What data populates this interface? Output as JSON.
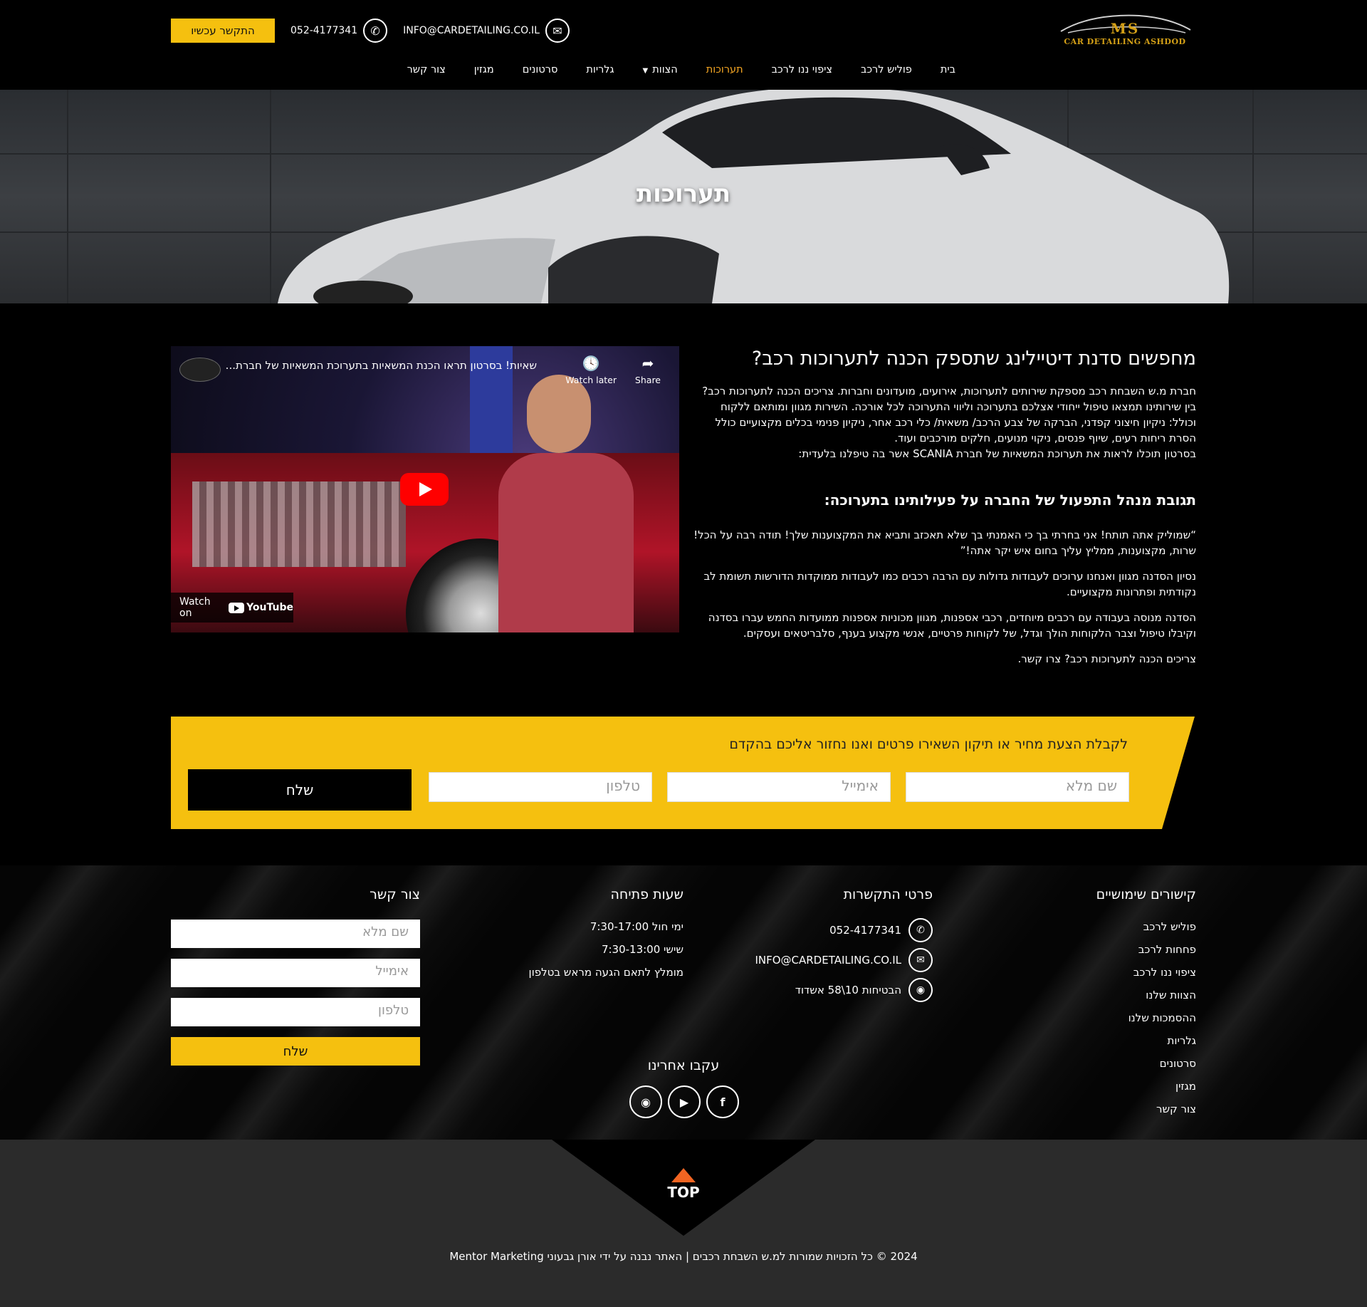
{
  "header": {
    "logo_text": "MS",
    "logo_tagline": "CAR DETAILING ASHDOD",
    "cta_label": "התקשר עכשיו",
    "phone": "052-4177341",
    "email": "INFO@CARDETAILING.CO.IL",
    "nav": [
      {
        "label": "בית",
        "active": false
      },
      {
        "label": "פוליש לרכב",
        "active": false
      },
      {
        "label": "ציפוי ננו לרכב",
        "active": false
      },
      {
        "label": "תערוכות",
        "active": true
      },
      {
        "label": "הצוות",
        "active": false,
        "dropdown": true
      },
      {
        "label": "גלריות",
        "active": false
      },
      {
        "label": "סרטונים",
        "active": false
      },
      {
        "label": "מגזין",
        "active": false
      },
      {
        "label": "צור קשר",
        "active": false
      }
    ]
  },
  "hero": {
    "title": "תערוכות"
  },
  "video": {
    "title": "שאיות! בסרטון תראו הכנת המשאיות בתערוכת המשאיות של חברת...",
    "watch_later": "Watch later",
    "share": "Share",
    "watch_on": "Watch on",
    "youtube": "YouTube"
  },
  "article": {
    "heading": "מחפשים סדנת דיטיילינג שתספק הכנה לתערוכות רכב?",
    "intro": [
      "חברת מ.ש השבחת רכב מספקת שירותים לתערוכות, אירועים, מועדונים וחברות. צריכים הכנה לתערוכות רכב?",
      "בין שירותינו תמצאו טיפול ייחודי אצלכם בתערוכה וליווי התערוכה לכל אורכה. השירות מגוון ומותאם ללקוח",
      "וכולל: ניקיון חיצוני קפדני, הברקה של צבע הרכב/ משאית/ כלי רכב אחר, ניקיון פנימי בכלים מקצועיים כולל",
      "הסרת ריחות רעים, שיוף פנסים, ניקוי מנועים, חלקים מורכבים ועוד.",
      " בסרטון תוכלו לראות את תערוכת המשאיות של חברת SCANIA אשר בה טיפלנו בלעדית:"
    ],
    "subheading": "תגובת מנהל התפעול של החברה על פעילותינו בתערוכה:",
    "quote": [
      "“שמוליק אתה תותח! אני בחרתי בך כי האמנתי בך שלא תאכזב ותביא את המקצוענות שלך! תודה רבה על הכל!",
      "שרות, מקצוענות, ממליץ עליך בחום איש יקר אתה!”"
    ],
    "para2": [
      "נסיון הסדנה מגוון ואנחנו ערוכים לעבודות גדולות עם הרבה רכבים כמו לעבודות ממוקדות הדורשות תשומת לב",
      "נקודתית ופתרונות מקצועיים."
    ],
    "para3": [
      "הסדנה מנוסה בעבודה עם רכבים מיוחדים, רכבי אספנות, מגוון מכוניות אספנות ממועדות החמש עברו בסדנה",
      "וקיבלו טיפול וצבר הלקוחות הולך וגדל, של לקוחות פרטיים, אנשי מקצוע בענף, סלבריטאים ועסקים."
    ],
    "closing": "צריכים הכנה לתערוכות רכב? צרו קשר."
  },
  "quote_form": {
    "title": "לקבלת הצעת מחיר או תיקון השאירו פרטים ואנו נחזור אליכם בהקדם",
    "name_placeholder": "שם מלא",
    "email_placeholder": "אימייל",
    "phone_placeholder": "טלפון",
    "send_label": "שלח"
  },
  "footer": {
    "links_title": "קישורים שימושיים",
    "links": [
      "פוליש לרכב",
      "פחחות לרכב",
      "ציפוי ננו לרכב",
      "הצוות שלנו",
      "ההסמכות שלנו",
      "גלריות",
      "סרטונים",
      "מגזין",
      "צור קשר"
    ],
    "contact_title": "פרטי התקשרות",
    "phone": "052-4177341",
    "email": "INFO@CARDETAILING.CO.IL",
    "address": "הבטיחות 10\\58 אשדוד",
    "hours_title": "שעות פתיחה",
    "hours": [
      "ימי חול 7:30-17:00",
      "שישי 7:30-13:00",
      "מומלץ לתאם הגעה מראש בטלפון"
    ],
    "form_title": "צור קשר",
    "name_placeholder": "שם מלא",
    "email_placeholder": "אימייל",
    "phone_placeholder": "טלפון",
    "send_label": "שלח",
    "follow_title": "עקבו אחרינו",
    "socials": [
      "instagram-icon",
      "youtube-icon",
      "facebook-icon"
    ]
  },
  "bottom": {
    "top_label": "TOP",
    "copyright": "2024 © כל הזכויות שמורות למ.ש השבחת רכבים | האתר נבנה על ידי אורן גבעוני Mentor Marketing"
  },
  "colors": {
    "accent": "#f5c00f",
    "active_nav": "#f5a623",
    "top_arrow": "#f26522"
  }
}
